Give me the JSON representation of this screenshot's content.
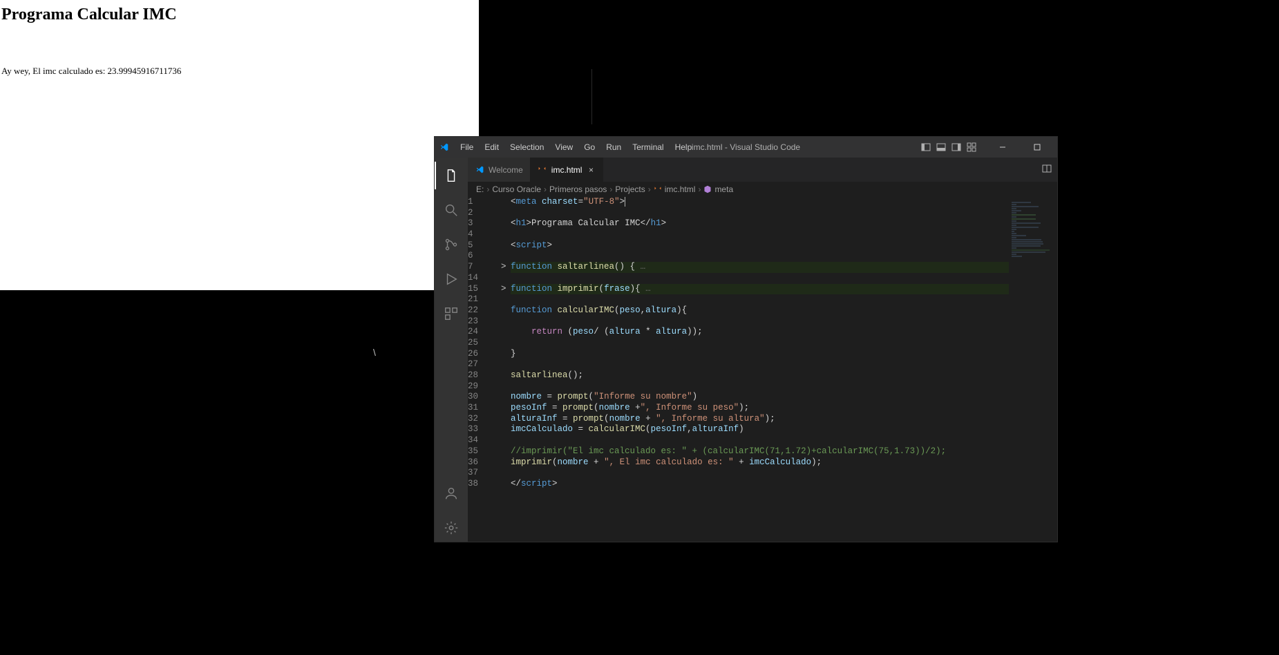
{
  "browser": {
    "heading": "Programa Calcular IMC",
    "output": "Ay wey, El imc calculado es: 23.99945916711736"
  },
  "vscode": {
    "title": "imc.html - Visual Studio Code",
    "menu": [
      "File",
      "Edit",
      "Selection",
      "View",
      "Go",
      "Run",
      "Terminal",
      "Help"
    ],
    "tabs": [
      {
        "label": "Welcome",
        "active": false,
        "icon": "vscode"
      },
      {
        "label": "imc.html",
        "active": true,
        "icon": "html"
      }
    ],
    "breadcrumbs": [
      "E:",
      "Curso Oracle",
      "Primeros pasos",
      "Projects",
      "imc.html",
      "meta"
    ],
    "code": {
      "lines": [
        {
          "n": 1,
          "fold": "",
          "hl": false,
          "segs": [
            [
              "punc",
              "<"
            ],
            [
              "tag",
              "meta"
            ],
            [
              "punc",
              " "
            ],
            [
              "attr",
              "charset"
            ],
            [
              "punc",
              "="
            ],
            [
              "str",
              "\"UTF-8\""
            ],
            [
              "punc",
              ">"
            ]
          ],
          "cursor": true
        },
        {
          "n": 2,
          "fold": "",
          "hl": false,
          "segs": []
        },
        {
          "n": 3,
          "fold": "",
          "hl": false,
          "segs": [
            [
              "punc",
              "<"
            ],
            [
              "tag",
              "h1"
            ],
            [
              "punc",
              ">"
            ],
            [
              "punc",
              "Programa Calcular IMC"
            ],
            [
              "punc",
              "</"
            ],
            [
              "tag",
              "h1"
            ],
            [
              "punc",
              ">"
            ]
          ]
        },
        {
          "n": 4,
          "fold": "",
          "hl": false,
          "segs": []
        },
        {
          "n": 5,
          "fold": "",
          "hl": false,
          "segs": [
            [
              "punc",
              "<"
            ],
            [
              "tag",
              "script"
            ],
            [
              "punc",
              ">"
            ]
          ]
        },
        {
          "n": 6,
          "fold": "",
          "hl": false,
          "segs": []
        },
        {
          "n": 7,
          "fold": ">",
          "hl": true,
          "segs": [
            [
              "kw",
              "function"
            ],
            [
              "punc",
              " "
            ],
            [
              "fn",
              "saltarlinea"
            ],
            [
              "punc",
              "() {"
            ],
            [
              "fold",
              " …"
            ]
          ]
        },
        {
          "n": 14,
          "fold": "",
          "hl": false,
          "segs": []
        },
        {
          "n": 15,
          "fold": ">",
          "hl": true,
          "segs": [
            [
              "kw",
              "function"
            ],
            [
              "punc",
              " "
            ],
            [
              "fn",
              "imprimir"
            ],
            [
              "punc",
              "("
            ],
            [
              "var",
              "frase"
            ],
            [
              "punc",
              "){"
            ],
            [
              "fold",
              " …"
            ]
          ]
        },
        {
          "n": 21,
          "fold": "",
          "hl": false,
          "segs": []
        },
        {
          "n": 22,
          "fold": "",
          "hl": false,
          "segs": [
            [
              "kw",
              "function"
            ],
            [
              "punc",
              " "
            ],
            [
              "fn",
              "calcularIMC"
            ],
            [
              "punc",
              "("
            ],
            [
              "var",
              "peso"
            ],
            [
              "punc",
              ","
            ],
            [
              "var",
              "altura"
            ],
            [
              "punc",
              "){"
            ]
          ]
        },
        {
          "n": 23,
          "fold": "",
          "hl": false,
          "segs": []
        },
        {
          "n": 24,
          "fold": "",
          "hl": false,
          "segs": [
            [
              "punc",
              "    "
            ],
            [
              "ret",
              "return"
            ],
            [
              "punc",
              " ("
            ],
            [
              "var",
              "peso"
            ],
            [
              "punc",
              "/ ("
            ],
            [
              "var",
              "altura"
            ],
            [
              "punc",
              " * "
            ],
            [
              "var",
              "altura"
            ],
            [
              "punc",
              "));"
            ]
          ]
        },
        {
          "n": 25,
          "fold": "",
          "hl": false,
          "segs": []
        },
        {
          "n": 26,
          "fold": "",
          "hl": false,
          "segs": [
            [
              "punc",
              "}"
            ]
          ]
        },
        {
          "n": 27,
          "fold": "",
          "hl": false,
          "segs": []
        },
        {
          "n": 28,
          "fold": "",
          "hl": false,
          "segs": [
            [
              "fn",
              "saltarlinea"
            ],
            [
              "punc",
              "();"
            ]
          ]
        },
        {
          "n": 29,
          "fold": "",
          "hl": false,
          "segs": []
        },
        {
          "n": 30,
          "fold": "",
          "hl": false,
          "segs": [
            [
              "var",
              "nombre"
            ],
            [
              "punc",
              " = "
            ],
            [
              "fn",
              "prompt"
            ],
            [
              "punc",
              "("
            ],
            [
              "str",
              "\"Informe su nombre\""
            ],
            [
              "punc",
              ")"
            ]
          ]
        },
        {
          "n": 31,
          "fold": "",
          "hl": false,
          "segs": [
            [
              "var",
              "pesoInf"
            ],
            [
              "punc",
              " = "
            ],
            [
              "fn",
              "prompt"
            ],
            [
              "punc",
              "("
            ],
            [
              "var",
              "nombre"
            ],
            [
              "punc",
              " +"
            ],
            [
              "str",
              "\", Informe su peso\""
            ],
            [
              "punc",
              ");"
            ]
          ]
        },
        {
          "n": 32,
          "fold": "",
          "hl": false,
          "segs": [
            [
              "var",
              "alturaInf"
            ],
            [
              "punc",
              " = "
            ],
            [
              "fn",
              "prompt"
            ],
            [
              "punc",
              "("
            ],
            [
              "var",
              "nombre"
            ],
            [
              "punc",
              " + "
            ],
            [
              "str",
              "\", Informe su altura\""
            ],
            [
              "punc",
              ");"
            ]
          ]
        },
        {
          "n": 33,
          "fold": "",
          "hl": false,
          "segs": [
            [
              "var",
              "imcCalculado"
            ],
            [
              "punc",
              " = "
            ],
            [
              "fn",
              "calcularIMC"
            ],
            [
              "punc",
              "("
            ],
            [
              "var",
              "pesoInf"
            ],
            [
              "punc",
              ","
            ],
            [
              "var",
              "alturaInf"
            ],
            [
              "punc",
              ")"
            ]
          ]
        },
        {
          "n": 34,
          "fold": "",
          "hl": false,
          "segs": []
        },
        {
          "n": 35,
          "fold": "",
          "hl": false,
          "segs": [
            [
              "comment",
              "//imprimir(\"El imc calculado es: \" + (calcularIMC(71,1.72)+calcularIMC(75,1.73))/2);"
            ]
          ]
        },
        {
          "n": 36,
          "fold": "",
          "hl": false,
          "segs": [
            [
              "fn",
              "imprimir"
            ],
            [
              "punc",
              "("
            ],
            [
              "var",
              "nombre"
            ],
            [
              "punc",
              " + "
            ],
            [
              "str",
              "\", El imc calculado es: \""
            ],
            [
              "punc",
              " + "
            ],
            [
              "var",
              "imcCalculado"
            ],
            [
              "punc",
              ");"
            ]
          ]
        },
        {
          "n": 37,
          "fold": "",
          "hl": false,
          "segs": []
        },
        {
          "n": 38,
          "fold": "",
          "hl": false,
          "segs": [
            [
              "punc",
              "</"
            ],
            [
              "tag",
              "script"
            ],
            [
              "punc",
              ">"
            ]
          ]
        }
      ]
    }
  }
}
